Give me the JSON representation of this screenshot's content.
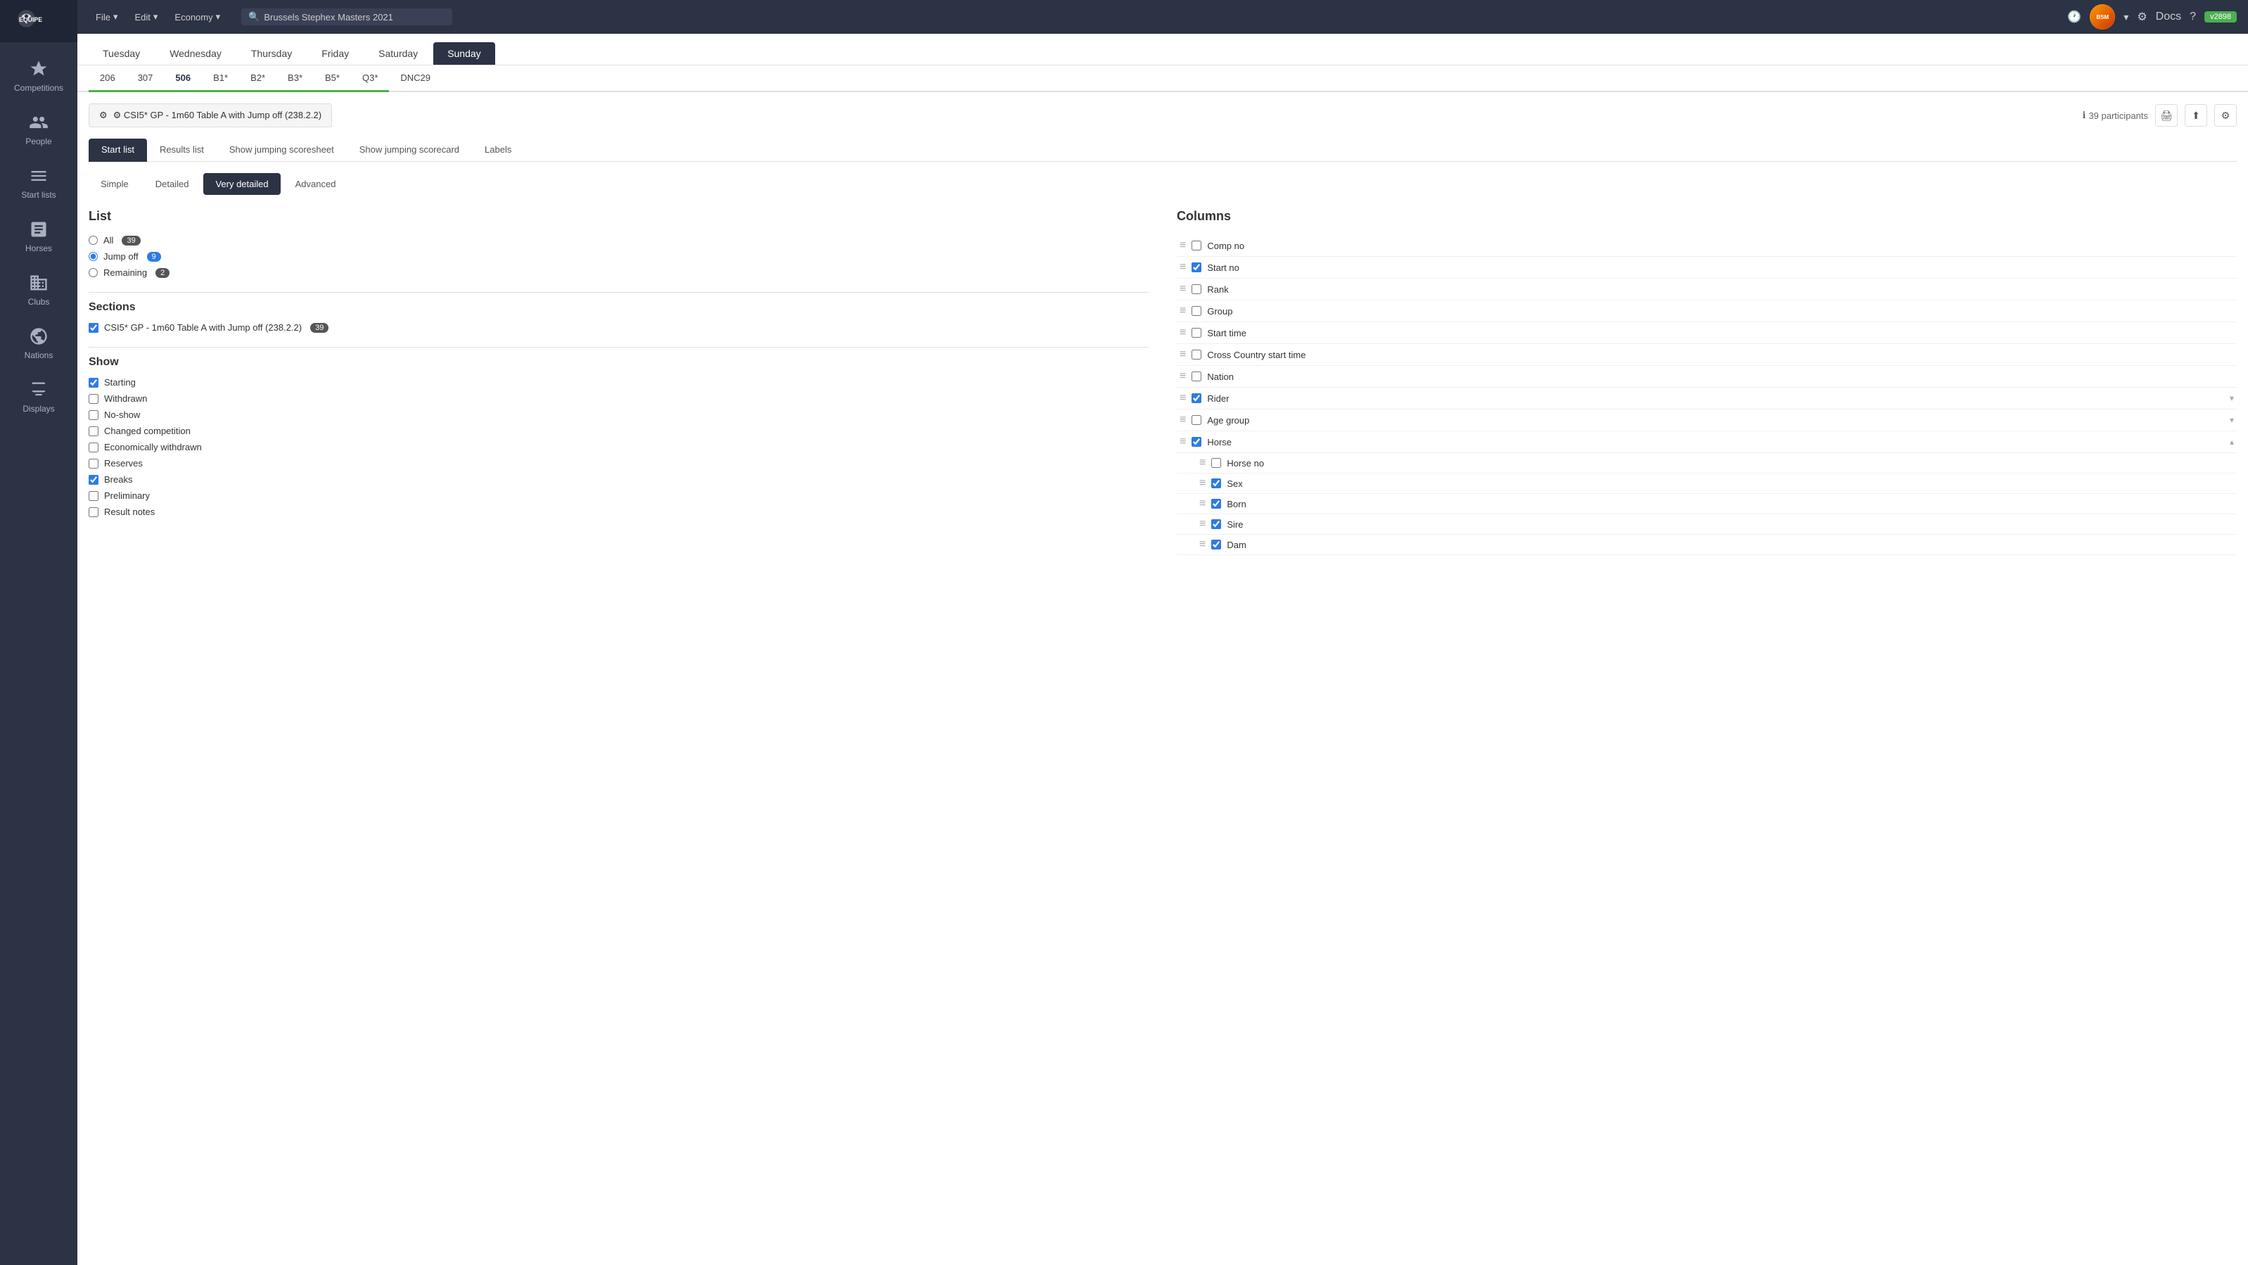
{
  "app": {
    "logo_text": "EQUIPE",
    "version": "v2898"
  },
  "topnav": {
    "menu_items": [
      {
        "label": "File",
        "has_arrow": true
      },
      {
        "label": "Edit",
        "has_arrow": true
      },
      {
        "label": "Economy",
        "has_arrow": true
      }
    ],
    "search_text": "Brussels Stephex Masters 2021",
    "search_icon": "🔍",
    "docs_label": "Docs"
  },
  "sidebar": {
    "items": [
      {
        "label": "Competitions",
        "icon": "trophy"
      },
      {
        "label": "People",
        "icon": "people"
      },
      {
        "label": "Start lists",
        "icon": "startlist"
      },
      {
        "label": "Horses",
        "icon": "horse"
      },
      {
        "label": "Clubs",
        "icon": "clubs"
      },
      {
        "label": "Nations",
        "icon": "nations"
      },
      {
        "label": "Displays",
        "icon": "displays"
      }
    ]
  },
  "day_tabs": [
    "Tuesday",
    "Wednesday",
    "Thursday",
    "Friday",
    "Saturday",
    "Sunday"
  ],
  "active_day": "Sunday",
  "comp_tabs": [
    {
      "label": "206",
      "color": "green"
    },
    {
      "label": "307",
      "color": "green"
    },
    {
      "label": "506",
      "color": "green",
      "active": true
    },
    {
      "label": "B1*",
      "color": "green"
    },
    {
      "label": "B2*",
      "color": "green"
    },
    {
      "label": "B3*",
      "color": "green"
    },
    {
      "label": "B5*",
      "color": "green"
    },
    {
      "label": "Q3*",
      "color": "green"
    },
    {
      "label": "DNC29",
      "color": "default"
    }
  ],
  "competition": {
    "title": "⚙ CSI5* GP - 1m60 Table A with Jump off (238.2.2)",
    "participants_count": "39 participants",
    "info_icon": "ℹ"
  },
  "view_tabs": [
    {
      "label": "Start list",
      "active": true
    },
    {
      "label": "Results list"
    },
    {
      "label": "Show jumping scoresheet"
    },
    {
      "label": "Show jumping scorecard"
    },
    {
      "label": "Labels"
    }
  ],
  "detail_tabs": [
    {
      "label": "Simple"
    },
    {
      "label": "Detailed"
    },
    {
      "label": "Very detailed",
      "active": true
    },
    {
      "label": "Advanced"
    }
  ],
  "list_section": {
    "title": "List",
    "options": [
      {
        "label": "All",
        "badge": "39",
        "value": "all"
      },
      {
        "label": "Jump off",
        "badge": "9",
        "value": "jump_off",
        "selected": true
      },
      {
        "label": "Remaining",
        "badge": "2",
        "value": "remaining"
      }
    ]
  },
  "sections_section": {
    "title": "Sections",
    "items": [
      {
        "label": "CSI5* GP - 1m60 Table A with Jump off (238.2.2)",
        "badge": "39",
        "checked": true
      }
    ]
  },
  "show_section": {
    "title": "Show",
    "items": [
      {
        "label": "Starting",
        "checked": true
      },
      {
        "label": "Withdrawn",
        "checked": false
      },
      {
        "label": "No-show",
        "checked": false
      },
      {
        "label": "Changed competition",
        "checked": false
      },
      {
        "label": "Economically withdrawn",
        "checked": false
      },
      {
        "label": "Reserves",
        "checked": false
      },
      {
        "label": "Breaks",
        "checked": true
      },
      {
        "label": "Preliminary",
        "checked": false
      },
      {
        "label": "Result notes",
        "checked": false
      }
    ]
  },
  "columns_section": {
    "title": "Columns",
    "items": [
      {
        "label": "Comp no",
        "checked": false,
        "has_expand": false,
        "sub_items": []
      },
      {
        "label": "Start no",
        "checked": true,
        "has_expand": false,
        "sub_items": []
      },
      {
        "label": "Rank",
        "checked": false,
        "has_expand": false,
        "sub_items": []
      },
      {
        "label": "Group",
        "checked": false,
        "has_expand": false,
        "sub_items": []
      },
      {
        "label": "Start time",
        "checked": false,
        "has_expand": false,
        "sub_items": []
      },
      {
        "label": "Cross Country start time",
        "checked": false,
        "has_expand": false,
        "sub_items": []
      },
      {
        "label": "Nation",
        "checked": false,
        "has_expand": false,
        "sub_items": []
      },
      {
        "label": "Rider",
        "checked": true,
        "has_expand": true,
        "expand_open": false,
        "sub_items": []
      },
      {
        "label": "Age group",
        "checked": false,
        "has_expand": true,
        "expand_open": false,
        "sub_items": []
      },
      {
        "label": "Horse",
        "checked": true,
        "has_expand": true,
        "expand_open": true,
        "sub_items": [
          {
            "label": "Horse no",
            "checked": false
          },
          {
            "label": "Sex",
            "checked": true
          },
          {
            "label": "Born",
            "checked": true
          },
          {
            "label": "Sire",
            "checked": true
          },
          {
            "label": "Dam",
            "checked": true
          }
        ]
      }
    ]
  }
}
